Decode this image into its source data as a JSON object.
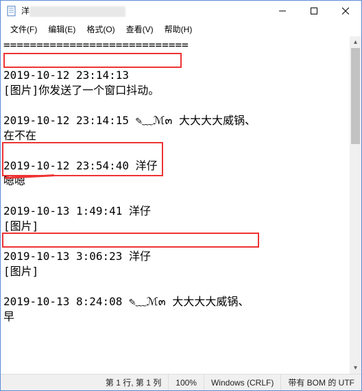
{
  "titlebar": {
    "title_prefix": "洋"
  },
  "menu": {
    "file": "文件(F)",
    "edit": "编辑(E)",
    "format": "格式(O)",
    "view": "查看(V)",
    "help": "帮助(H)"
  },
  "body": {
    "sep": "============================",
    "e1_ts": "2019-10-12 23:14:13",
    "e1_ln": "[图片]你发送了一个窗口抖动。",
    "e2_ts": "2019-10-12 23:14:15 ✎﹏ℳ๓ 大大大大威锅、",
    "e2_ln": "在不在",
    "e3_ts": "2019-10-12 23:54:40 洋仔",
    "e3_ln": "嗯嗯",
    "e4_ts": "2019-10-13 1:49:41 洋仔",
    "e4_ln": "[图片]",
    "e5_ts": "2019-10-13 3:06:23 洋仔",
    "e5_ln": "[图片]",
    "e6_ts": "2019-10-13 8:24:08 ✎﹏ℳ๓ 大大大大威锅、",
    "e6_ln": "早"
  },
  "status": {
    "pos": "第 1 行,  第 1 列",
    "zoom": "100%",
    "eol": "Windows (CRLF)",
    "enc": "带有 BOM 的 UTF"
  }
}
